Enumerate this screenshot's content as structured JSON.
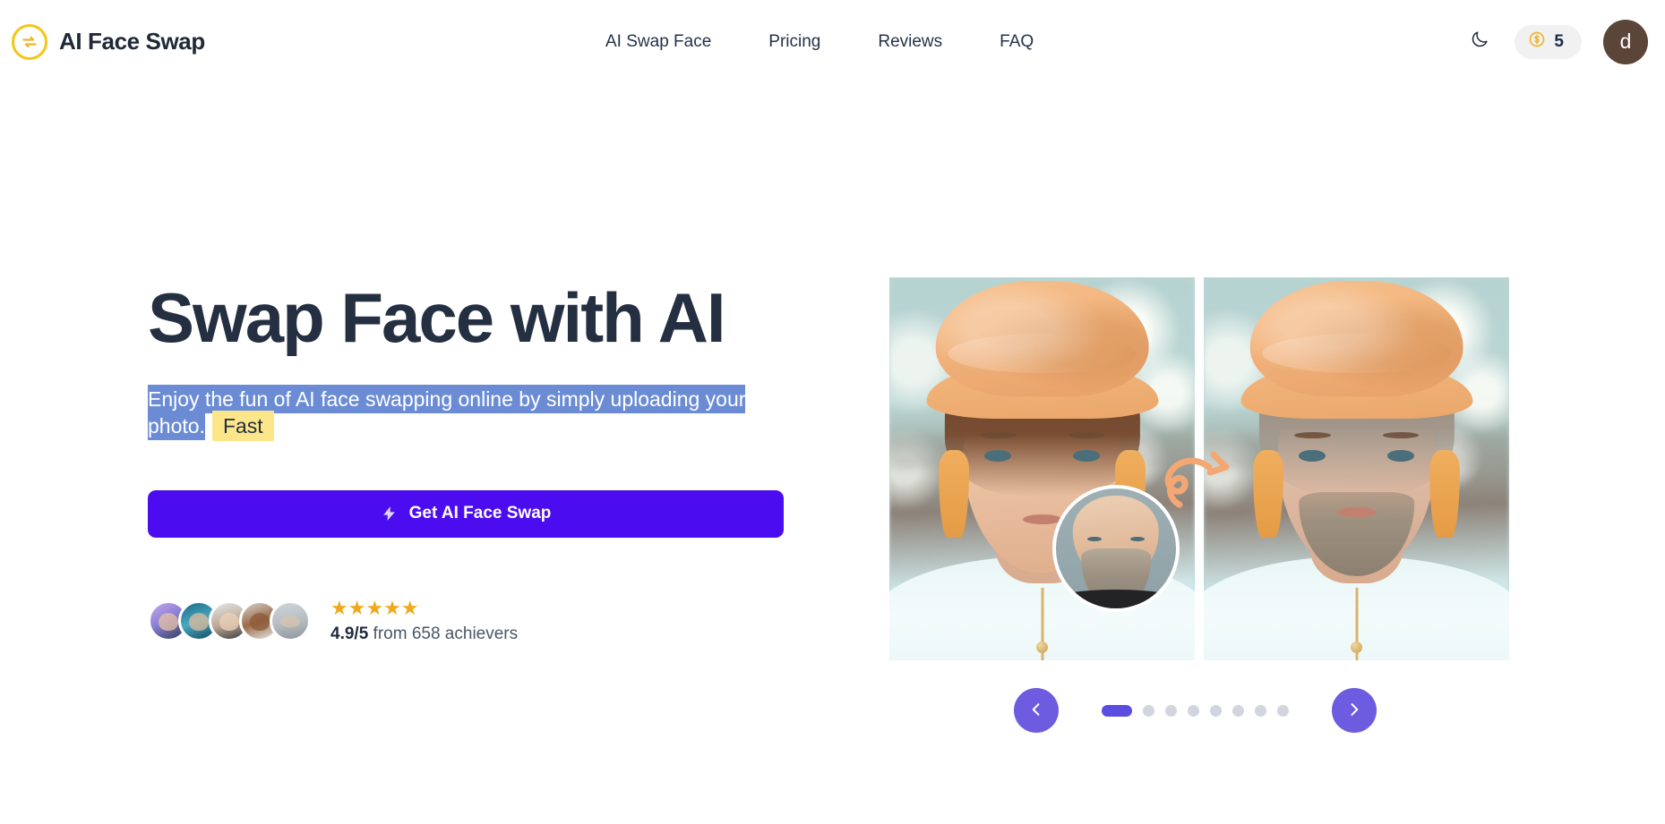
{
  "header": {
    "brand": {
      "name": "AI Face Swap",
      "logo_icon": "swap-arrows-circle-icon",
      "logo_color": "#f5c518"
    },
    "nav": [
      {
        "label": "AI Swap Face"
      },
      {
        "label": "Pricing"
      },
      {
        "label": "Reviews"
      },
      {
        "label": "FAQ"
      }
    ],
    "theme_toggle": {
      "icon": "moon-icon",
      "title": "Dark mode"
    },
    "credits": {
      "icon": "dollar-coin-icon",
      "value": "5",
      "icon_color": "#f0b429"
    },
    "avatar": {
      "initial": "d",
      "color": "#5b4438"
    }
  },
  "hero": {
    "title": "Swap Face with AI",
    "subtitle_selected": "Enjoy the fun of AI face swapping online by simply uploading your photo.",
    "subtitle_highlight": "Fast",
    "cta": {
      "label": "Get AI Face Swap",
      "icon": "lightning-bolt-icon",
      "color": "#4b0df0"
    },
    "social_proof": {
      "stars": "★★★★★",
      "star_count": 5,
      "score": "4.9/5",
      "from_text": "from 658 achievers",
      "avatar_count": 5
    }
  },
  "showcase": {
    "before_label": "woman-with-orange-turban-before",
    "after_label": "woman-with-orange-turban-face-swapped",
    "inset_label": "bearded-man-source-face",
    "arrow_label": "swap-direction-arrow"
  },
  "carousel": {
    "prev_icon": "chevron-left-icon",
    "next_icon": "chevron-right-icon",
    "total_slides": 8,
    "active_index": 0,
    "accent_color": "#6d5ce0"
  }
}
